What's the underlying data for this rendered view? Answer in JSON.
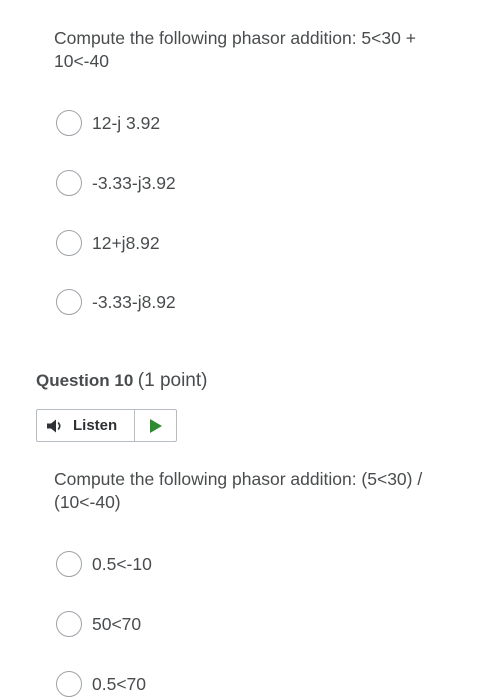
{
  "question9": {
    "prompt": "Compute the following phasor addition: 5<30 + 10<-40",
    "options": [
      {
        "label": "12-j 3.92"
      },
      {
        "label": "-3.33-j3.92"
      },
      {
        "label": "12+j8.92"
      },
      {
        "label": "-3.33-j8.92"
      }
    ]
  },
  "question10": {
    "title": "Question 10",
    "points": "(1 point)",
    "listen": {
      "label": "Listen",
      "speaker_icon": "speaker-icon",
      "play_icon": "play-icon",
      "play_color": "#2e8b2e"
    },
    "prompt": "Compute the following phasor addition: (5<30) / (10<-40)",
    "options": [
      {
        "label": "0.5<-10"
      },
      {
        "label": "50<70"
      },
      {
        "label": "0.5<70"
      }
    ]
  }
}
